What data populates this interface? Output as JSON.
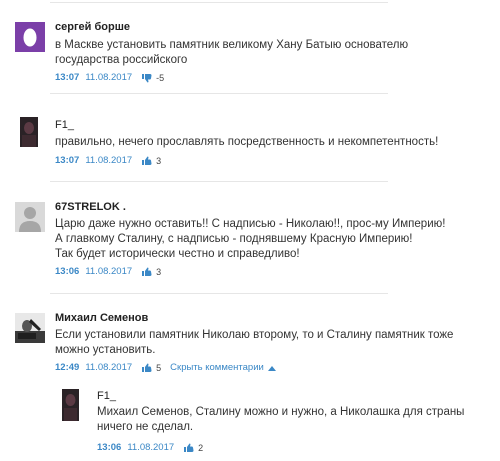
{
  "comments": [
    {
      "author": "сергей борше",
      "lines": [
        "в Масквe установить памятник великому Хану Батыю основателю",
        "государства российского"
      ],
      "time": "13:07",
      "date": "11.08.2017",
      "rating": "-5",
      "rating_type": "thumb-down",
      "avatar": "purple-egg"
    },
    {
      "author": "F1_",
      "lines": [
        "правильно, нечего прославлять посредственность и некомпетентность!"
      ],
      "time": "13:07",
      "date": "11.08.2017",
      "rating": "3",
      "rating_type": "thumb-up",
      "avatar": "photo-dark"
    },
    {
      "author": "67STRELOK .",
      "lines": [
        "Царю даже нужно оставить!! С надписью - Николаю!!, прос-му Империю!",
        "А главкому Сталину, с надписью - поднявшему Красную Империю!",
        "Так будет исторически честно и справедливо!"
      ],
      "time": "13:06",
      "date": "11.08.2017",
      "rating": "3",
      "rating_type": "thumb-up",
      "avatar": "default-silhouette"
    },
    {
      "author": "Михаил Семенов",
      "lines": [
        "Если установили памятник Николаю второму, то и Сталину памятник тоже",
        "можно установить."
      ],
      "time": "12:49",
      "date": "11.08.2017",
      "rating": "5",
      "rating_type": "thumb-up",
      "avatar": "photo-bw",
      "toggle_label": "Скрыть комментарии"
    },
    {
      "author": "F1_",
      "lines": [
        "Михаил Семенов, Сталину можно и нужно, а Николашка для страны",
        "ничего не сделал."
      ],
      "time": "13:06",
      "date": "11.08.2017",
      "rating": "2",
      "rating_type": "thumb-up",
      "avatar": "photo-dark"
    }
  ],
  "colors": {
    "link": "#3b88c6",
    "divider": "#e6e6e6",
    "text": "#333333",
    "avatar_purple": "#7b3fa8"
  }
}
